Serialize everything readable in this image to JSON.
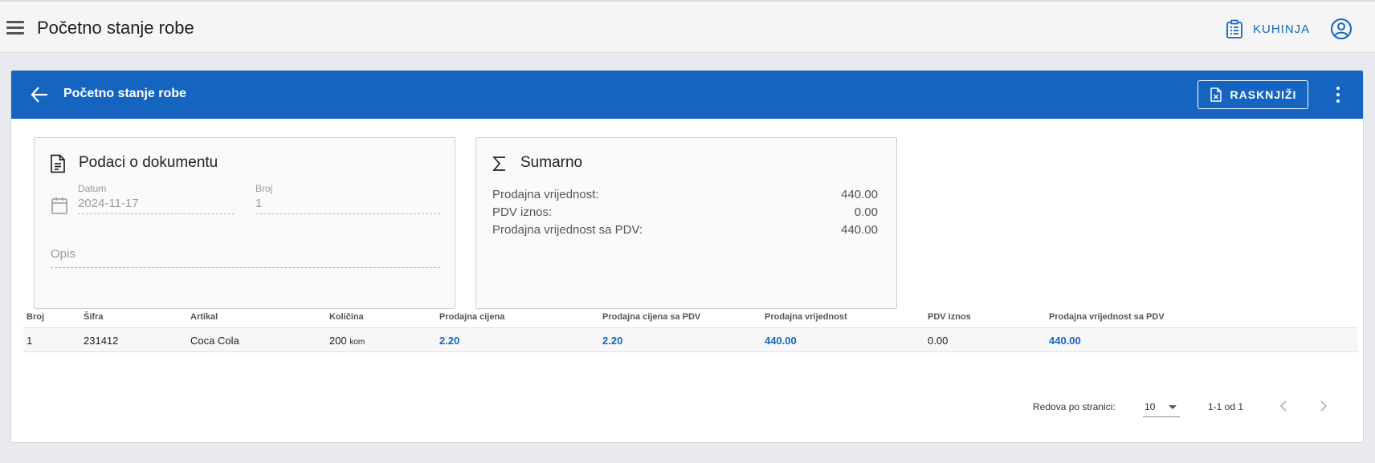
{
  "appbar": {
    "title": "Početno stanje robe",
    "kitchen_label": "KUHINJA"
  },
  "card": {
    "title": "Početno stanje robe",
    "rasknjizi_label": "RASKNJIŽI"
  },
  "document": {
    "title": "Podaci o dokumentu",
    "datum_label": "Datum",
    "datum_value": "2024-11-17",
    "broj_label": "Broj",
    "broj_value": "1",
    "opis_placeholder": "Opis"
  },
  "summary": {
    "title": "Sumarno",
    "rows": [
      {
        "label": "Prodajna vrijednost:",
        "value": "440.00"
      },
      {
        "label": "PDV iznos:",
        "value": "0.00"
      },
      {
        "label": "Prodajna vrijednost sa PDV:",
        "value": "440.00"
      }
    ]
  },
  "table": {
    "columns": [
      "Broj",
      "Šifra",
      "Artikal",
      "Količina",
      "Prodajna cijena",
      "Prodajna cijena sa PDV",
      "Prodajna vrijednost",
      "PDV iznos",
      "Prodajna vrijednost sa PDV"
    ],
    "rows": [
      {
        "broj": "1",
        "sifra": "231412",
        "artikal": "Coca Cola",
        "kolicina": "200",
        "unit": "kom",
        "prodajna_cijena": "2.20",
        "prodajna_cijena_pdv": "2.20",
        "prodajna_vrijednost": "440.00",
        "pdv_iznos": "0.00",
        "prodajna_vrijednost_pdv": "440.00"
      }
    ]
  },
  "pagination": {
    "rows_per_page_label": "Redova po stranici:",
    "rows_per_page_value": "10",
    "range": "1-1 od 1"
  },
  "colors": {
    "primary": "#1565c0",
    "appbar_bg": "#f5f5f5",
    "page_bg": "#e9eaef"
  }
}
